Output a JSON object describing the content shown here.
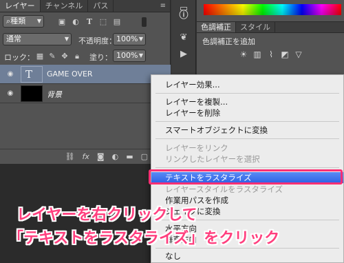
{
  "layers_panel": {
    "tabs": [
      "レイヤー",
      "チャンネル",
      "パス"
    ],
    "filter_kind": "種類",
    "blend_mode": "通常",
    "opacity_label": "不透明度：",
    "opacity_value": "100%",
    "lock_label": "ロック：",
    "fill_label": "塗り：",
    "fill_value": "100%",
    "layers": [
      {
        "name": "GAME OVER",
        "thumb_glyph": "T",
        "selected": true
      },
      {
        "name": "背景",
        "selected": false
      }
    ]
  },
  "adjustments_panel": {
    "tabs": [
      "色調補正",
      "スタイル"
    ],
    "title": "色調補正を追加"
  },
  "context_menu": {
    "items": [
      {
        "label": "レイヤー効果...",
        "disabled": false
      },
      {
        "label": "レイヤーを複製...",
        "disabled": false
      },
      {
        "label": "レイヤーを削除",
        "disabled": false
      },
      {
        "label": "スマートオブジェクトに変換",
        "disabled": false
      },
      {
        "label": "レイヤーをリンク",
        "disabled": true
      },
      {
        "label": "リンクしたレイヤーを選択",
        "disabled": true
      },
      {
        "label": "テキストをラスタライズ",
        "disabled": false,
        "highlighted": true
      },
      {
        "label": "レイヤースタイルをラスタライズ",
        "disabled": true
      },
      {
        "label": "作業用パスを作成",
        "disabled": false
      },
      {
        "label": "シェイプに変換",
        "disabled": false
      },
      {
        "label": "水平方向",
        "disabled": false
      },
      {
        "label": "垂直方向",
        "disabled": false
      },
      {
        "label": "なし",
        "disabled": false
      }
    ]
  },
  "annotation": {
    "line1": "レイヤーを右クリックして",
    "line2": "「テキストをラスタライズ」をクリック"
  },
  "colors": {
    "highlight_border": "#ff2f73",
    "annotation_text": "#ff3f7e",
    "menu_highlight": "#3a6ff0",
    "selected_layer": "#6f7f98"
  }
}
